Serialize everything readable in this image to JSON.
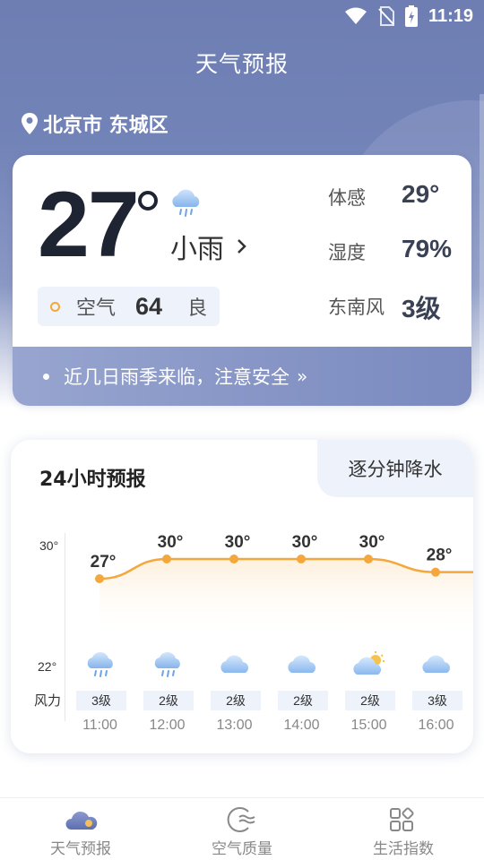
{
  "status_bar": {
    "time": "11:19",
    "icons": [
      "wifi-icon",
      "no-sim-icon",
      "battery-charging-icon"
    ]
  },
  "header": {
    "title": "天气预报"
  },
  "location": {
    "name": "北京市 东城区",
    "icon": "location-pin-icon"
  },
  "current": {
    "temperature": "27",
    "condition": "小雨",
    "condition_icon": "light-rain-icon",
    "air": {
      "label": "空气",
      "value": "64",
      "level": "良"
    },
    "stats": [
      {
        "label": "体感",
        "value": "29°"
      },
      {
        "label": "湿度",
        "value": "79%"
      },
      {
        "label": "东南风",
        "value": "3级"
      }
    ],
    "alert": "近几日雨季来临，注意安全"
  },
  "hourly": {
    "title": "24小时预报",
    "minute_tab": "逐分钟降水",
    "axis_max": "30°",
    "axis_min": "22°",
    "wind_label": "风力",
    "items": [
      {
        "time": "11:00",
        "temp": 27,
        "temp_label": "27°",
        "icon": "light-rain-icon",
        "wind": "3级"
      },
      {
        "time": "12:00",
        "temp": 30,
        "temp_label": "30°",
        "icon": "light-rain-icon",
        "wind": "2级"
      },
      {
        "time": "13:00",
        "temp": 30,
        "temp_label": "30°",
        "icon": "cloudy-icon",
        "wind": "2级"
      },
      {
        "time": "14:00",
        "temp": 30,
        "temp_label": "30°",
        "icon": "cloudy-icon",
        "wind": "2级"
      },
      {
        "time": "15:00",
        "temp": 30,
        "temp_label": "30°",
        "icon": "partly-sunny-icon",
        "wind": "2级"
      },
      {
        "time": "16:00",
        "temp": 28,
        "temp_label": "28°",
        "icon": "cloudy-icon",
        "wind": "3级"
      }
    ]
  },
  "nav": [
    {
      "label": "天气预报",
      "icon": "weather-forecast-icon",
      "active": true
    },
    {
      "label": "空气质量",
      "icon": "air-quality-icon",
      "active": false
    },
    {
      "label": "生活指数",
      "icon": "life-index-icon",
      "active": false
    }
  ],
  "colors": {
    "accent": "#7283b8",
    "line": "#f4a73c",
    "pill": "#edf2fb"
  }
}
